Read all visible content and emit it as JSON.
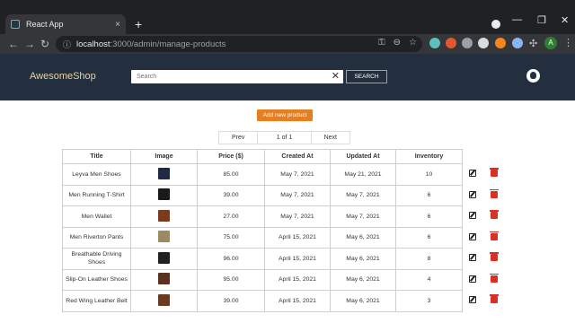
{
  "browser": {
    "tab_title": "React App",
    "tab_close": "×",
    "new_tab": "+",
    "url_host": "localhost",
    "url_rest": ":3000/admin/manage-products",
    "profile_initial": "A",
    "window_controls": [
      "—",
      "❐",
      "✕"
    ]
  },
  "header": {
    "brand": "AwesomeShop",
    "search_placeholder": "Search",
    "search_clear": "✕",
    "search_button": "SEARCH"
  },
  "content": {
    "add_button": "Add new product",
    "pager": {
      "prev": "Prev",
      "page": "1 of 1",
      "next": "Next"
    },
    "columns": [
      "Title",
      "Image",
      "Price ($)",
      "Created At",
      "Updated At",
      "Inventory"
    ],
    "rows": [
      {
        "title": "Leyva Men Shoes",
        "price": "85.00",
        "created": "May 7, 2021",
        "updated": "May 21, 2021",
        "inventory": "10",
        "thumb_color": "#1f2a44"
      },
      {
        "title": "Men Running T-Shirt",
        "price": "39.00",
        "created": "May 7, 2021",
        "updated": "May 7, 2021",
        "inventory": "6",
        "thumb_color": "#1a1a1a"
      },
      {
        "title": "Men Wallet",
        "price": "27.00",
        "created": "May 7, 2021",
        "updated": "May 7, 2021",
        "inventory": "6",
        "thumb_color": "#7a3b1e"
      },
      {
        "title": "Men Riverton Pants",
        "price": "75.00",
        "created": "April 15, 2021",
        "updated": "May 6, 2021",
        "inventory": "6",
        "thumb_color": "#9c8a64"
      },
      {
        "title": "Breathable Driving Shoes",
        "price": "96.00",
        "created": "April 15, 2021",
        "updated": "May 6, 2021",
        "inventory": "8",
        "thumb_color": "#222222"
      },
      {
        "title": "Slip-On Leather Shoes",
        "price": "95.00",
        "created": "April 15, 2021",
        "updated": "May 6, 2021",
        "inventory": "4",
        "thumb_color": "#5a3320"
      },
      {
        "title": "Red Wing Leather Belt",
        "price": "39.00",
        "created": "April 15, 2021",
        "updated": "May 6, 2021",
        "inventory": "3",
        "thumb_color": "#6b3a22"
      }
    ]
  },
  "colors": {
    "header_bg": "#232f3e",
    "brand": "#e8d49a",
    "accent": "#e67e22",
    "delete": "#d93025"
  }
}
